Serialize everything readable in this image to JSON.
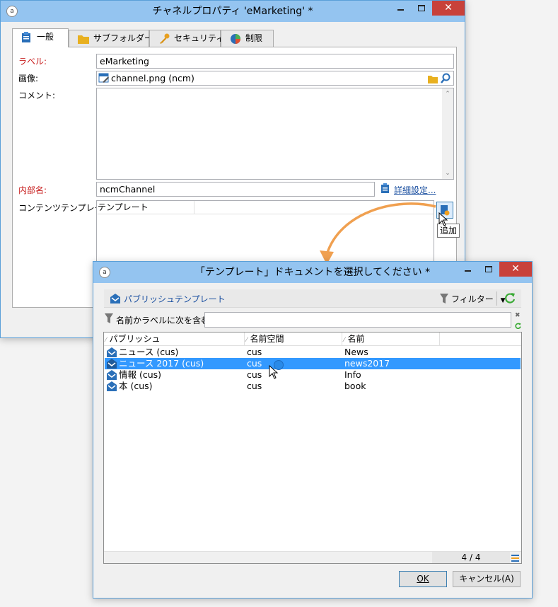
{
  "main_window": {
    "title": "チャネルプロパティ 'eMarketing' *",
    "tabs": [
      {
        "label": "一般",
        "icon": "clipboard-icon"
      },
      {
        "label": "サブフォルダー",
        "icon": "folder-icon"
      },
      {
        "label": "セキュリティ",
        "icon": "key-icon"
      },
      {
        "label": "制限",
        "icon": "pie-chart-icon"
      }
    ],
    "label_caption": "ラベル:",
    "label_value": "eMarketing",
    "image_caption": "画像:",
    "image_value": "channel.png (ncm)",
    "comment_caption": "コメント:",
    "comment_value": "",
    "internal_name_caption": "内部名:",
    "internal_name_value": "ncmChannel",
    "advanced_settings_link": "詳細設定...",
    "content_template_caption": "コンテンツテンプレート:",
    "template_column_header": "テンプレート",
    "add_tooltip": "追加"
  },
  "dialog": {
    "title": "「テンプレート」ドキュメントを選択してください *",
    "folder_label": "パブリッシュテンプレート",
    "filter_label": "フィルター",
    "search_caption": "名前かラベルに次を含む:",
    "search_value": "",
    "columns": [
      "パブリッシュ",
      "名前空間",
      "名前"
    ],
    "rows": [
      {
        "publish": "ニュース (cus)",
        "namespace": "cus",
        "name": "News",
        "selected": false
      },
      {
        "publish": "ニュース 2017 (cus)",
        "namespace": "cus",
        "name": "news2017",
        "selected": true
      },
      {
        "publish": "情報 (cus)",
        "namespace": "cus",
        "name": "Info",
        "selected": false
      },
      {
        "publish": "本 (cus)",
        "namespace": "cus",
        "name": "book",
        "selected": false
      }
    ],
    "count": "4 / 4",
    "ok_label": "OK",
    "cancel_label": "キャンセル(A)"
  },
  "colors": {
    "titlebar": "#94c4f0",
    "close_button": "#c8413a",
    "selection": "#3399ff",
    "required_label": "#c81e1e",
    "link": "#1a4fa0",
    "arrow": "#f0a050"
  }
}
